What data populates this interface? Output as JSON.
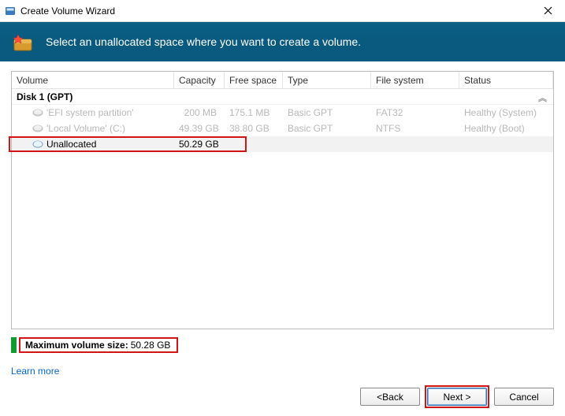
{
  "window": {
    "title": "Create Volume Wizard"
  },
  "banner": {
    "text": "Select an unallocated space where you want to create a volume."
  },
  "grid": {
    "headers": {
      "volume": "Volume",
      "capacity": "Capacity",
      "free": "Free space",
      "type": "Type",
      "fs": "File system",
      "status": "Status"
    },
    "disk_label": "Disk 1 (GPT)",
    "rows": [
      {
        "volume": "'EFI system partition'",
        "capacity": "200 MB",
        "free": "175.1 MB",
        "type": "Basic GPT",
        "fs": "FAT32",
        "status": "Healthy (System)",
        "dim": true
      },
      {
        "volume": "'Local Volume' (C:)",
        "capacity": "49.39 GB",
        "free": "38.80 GB",
        "type": "Basic GPT",
        "fs": "NTFS",
        "status": "Healthy (Boot)",
        "dim": true
      },
      {
        "volume": "Unallocated",
        "capacity": "50.29 GB",
        "free": "",
        "type": "",
        "fs": "",
        "status": "",
        "dim": false,
        "selected": true
      }
    ]
  },
  "maxsize": {
    "label": "Maximum volume size:",
    "value": "50.28 GB"
  },
  "learn_more": "Learn more",
  "buttons": {
    "back": "Back",
    "next": "Next >",
    "cancel": "Cancel"
  }
}
